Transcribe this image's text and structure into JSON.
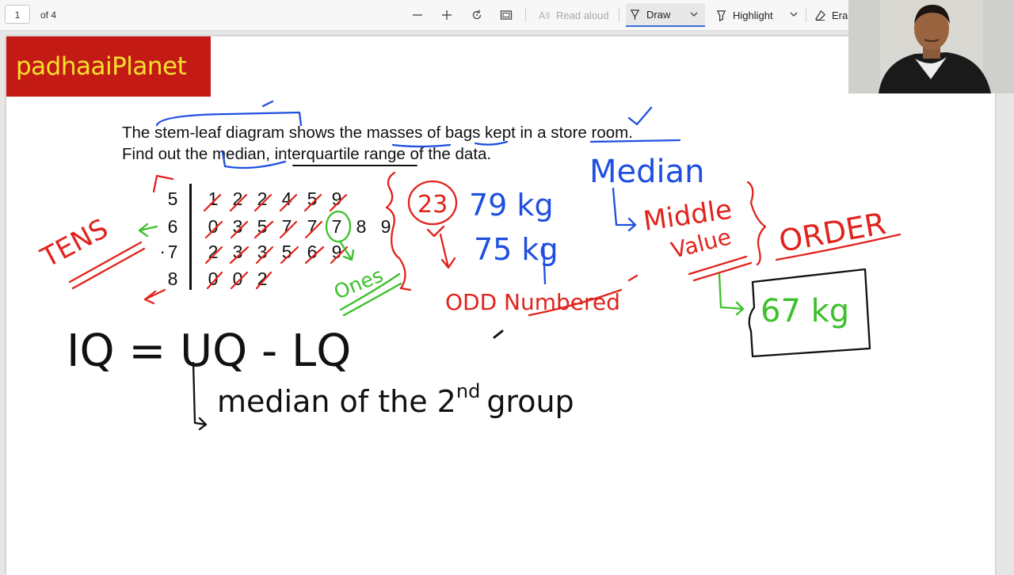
{
  "toolbar": {
    "page_number": "1",
    "page_total": "of 4",
    "read_aloud": "Read aloud",
    "draw": "Draw",
    "highlight": "Highlight",
    "erase": "Eras"
  },
  "logo": "padhaaiPlanet",
  "question": {
    "line1": "The stem-leaf diagram shows the masses of bags kept in a store room.",
    "line2": "Find out the median, interquartile range of the data."
  },
  "stemleaf": {
    "stems": [
      "5",
      "6",
      "7",
      "8"
    ],
    "leaves": [
      [
        "1",
        "2",
        "2",
        "4",
        "5",
        "9"
      ],
      [
        "0",
        "3",
        "5",
        "7",
        "7",
        "7",
        "8",
        "9"
      ],
      [
        "2",
        "3",
        "3",
        "5",
        "6",
        "9"
      ],
      [
        "0",
        "0",
        "2"
      ]
    ],
    "stem_marker": "."
  },
  "annotations": {
    "tens": "TENS",
    "ones": "Ones",
    "count": "23",
    "kg1": "79 kg",
    "kg2": "75 kg",
    "odd": "ODD Numbered",
    "median_title": "Median",
    "middle": "Middle",
    "value": "Value",
    "order": "ORDER",
    "answer": "67 kg",
    "iq_formula": "IQ = UQ - LQ",
    "median_2nd_prefix": "median of the 2",
    "median_2nd_sup": "nd",
    "median_2nd_suffix": "group"
  },
  "colors": {
    "ink_red": "#e0231c",
    "ink_blue": "#1f4fe0",
    "ink_green": "#3bc12a",
    "ink_black": "#111111",
    "logo_bg": "#c31a16",
    "logo_text": "#f5e12a"
  },
  "icons": [
    "zoom-out-icon",
    "zoom-in-icon",
    "rotate-icon",
    "fit-page-icon",
    "read-aloud-icon",
    "draw-icon",
    "highlight-icon",
    "eraser-icon"
  ]
}
